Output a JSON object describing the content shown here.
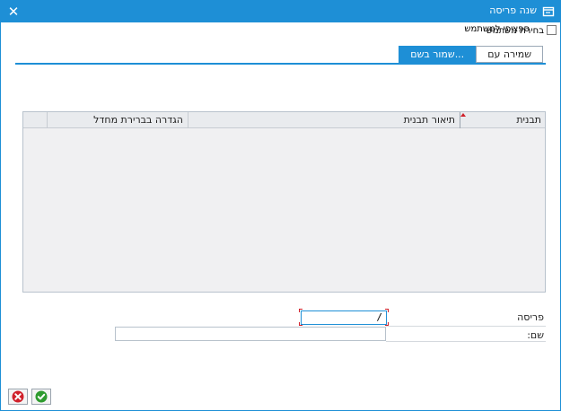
{
  "window": {
    "title": "שנה פריסה",
    "close_glyph": "✕"
  },
  "options": {
    "checkbox_label": "בחירת משתמש",
    "checkbox_overlay": "ספציפי למשתמש"
  },
  "tabs": [
    {
      "label": "שמירה עם",
      "active": false
    },
    {
      "label": "שמור בשם...",
      "active": true
    }
  ],
  "grid": {
    "columns": [
      {
        "label": "תבנית"
      },
      {
        "label": "תיאור תבנית"
      },
      {
        "label": "הגדרה בברירת מחדל"
      },
      {
        "label": ""
      }
    ],
    "rows": []
  },
  "form": {
    "period_label": "פריסה",
    "period_value": "/",
    "name_label": "שם:",
    "name_value": ""
  },
  "colors": {
    "accent": "#1e8fd6",
    "cancel": "#d0202a",
    "ok": "#2e9b2e"
  }
}
